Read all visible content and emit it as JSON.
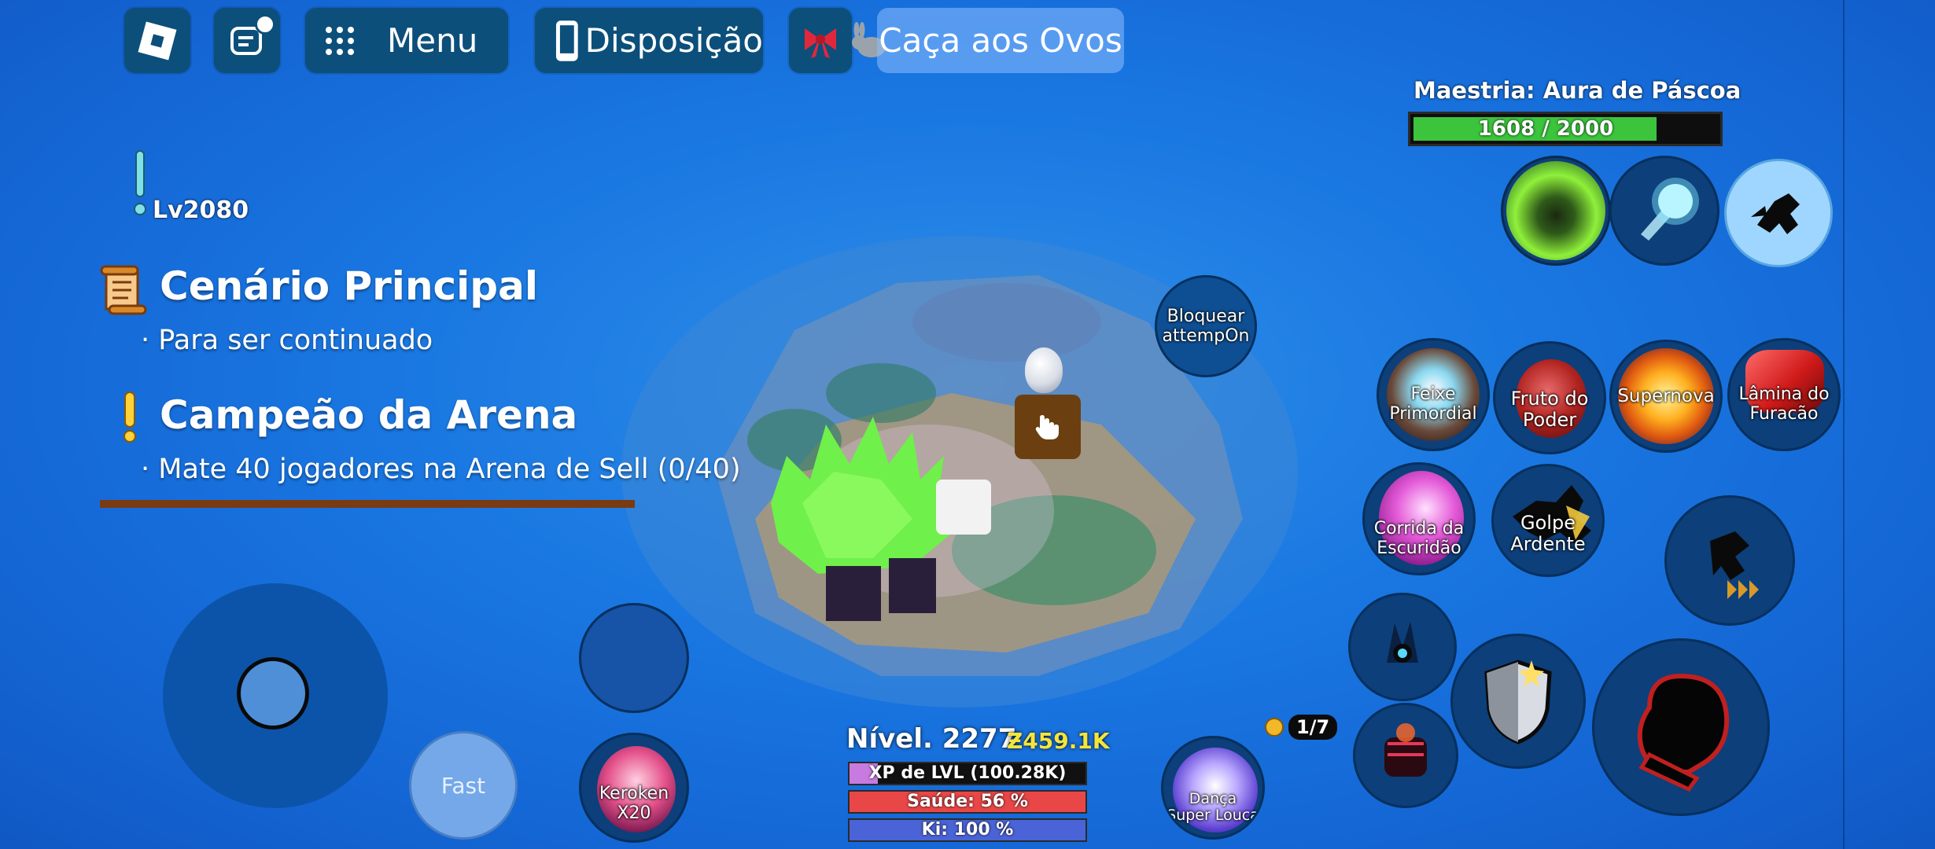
{
  "topbar": {
    "menu_label": "Menu",
    "layout_label": "Disposição",
    "event_label": "Caça aos Ovos"
  },
  "player": {
    "level_tag": "Lv2080"
  },
  "quests": [
    {
      "title": "Cenário Principal",
      "subtitle": "· Para ser continuado"
    },
    {
      "title": "Campeão da Arena",
      "subtitle": "· Mate 40 jogadores na Arena de Sell (0/40)"
    }
  ],
  "mastery": {
    "title": "Maestria: Aura de Páscoa",
    "progress_text": "1608 / 2000",
    "progress_fraction": 0.804
  },
  "center": {
    "block_button": "Bloquear attempOn"
  },
  "skills": {
    "feixe": "Feixe Primordial",
    "fruto": "Fruto do Poder",
    "supernova": "Supernova",
    "lamina": "Lâmina do Furacão",
    "corrida": "Corrida da Escuridão",
    "golpe": "Golpe Ardente",
    "fast": "Fast",
    "keroken": "Keroken X20",
    "danca": "Dança Super Louca"
  },
  "counter": {
    "text": "1/7"
  },
  "stats": {
    "level_text": "Nível. 2277",
    "currency_text": "Ƶ459.1K",
    "xp_text": "XP de LVL (100.28K)",
    "xp_fraction": 0.12,
    "health_text": "Saúde: 56 %",
    "health_fraction": 1.0,
    "ki_text": "Ki: 100 %",
    "ki_fraction": 1.0
  },
  "colors": {
    "topbar_bg": "#0c4f7a",
    "mastery_fill": "#3cc43c",
    "xp_fill": "#c77be0",
    "health_fill": "#e94747",
    "ki_fill": "#4a63d6",
    "currency": "#f5e53b",
    "divider": "#7a3a12"
  }
}
